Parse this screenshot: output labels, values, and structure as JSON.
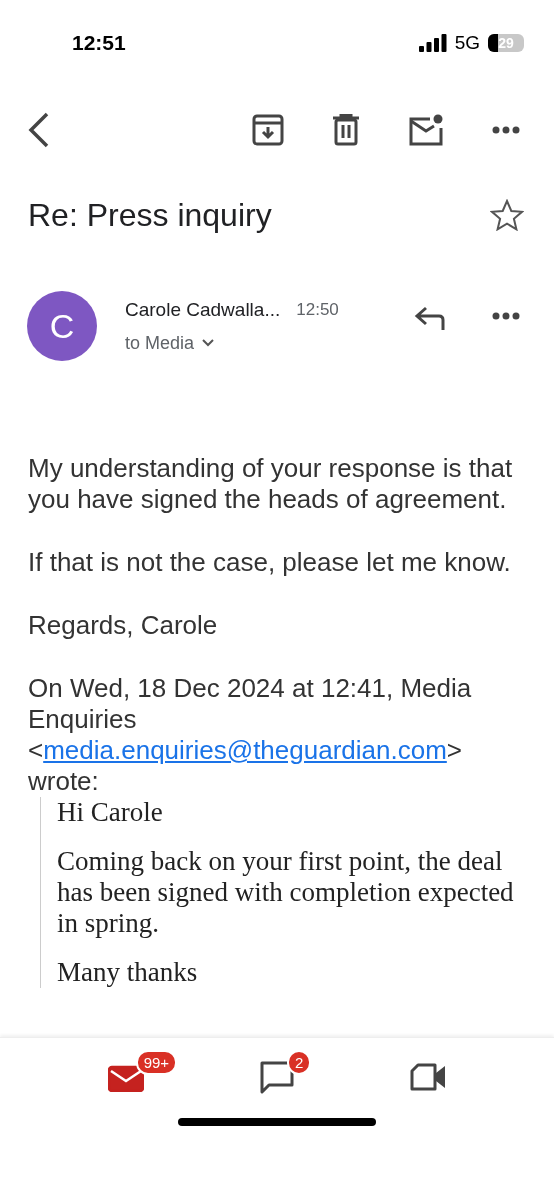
{
  "status_bar": {
    "time": "12:51",
    "network": "5G",
    "battery": "29"
  },
  "subject": "Re: Press inquiry",
  "starred": false,
  "message": {
    "avatar_letter": "C",
    "sender": "Carole Cadwalla...",
    "time": "12:50",
    "recipients": "to Media"
  },
  "body": [
    "My understanding of your response is that you have signed the heads of agreement.",
    "If that is not the case, please let me know.",
    "Regards, Carole"
  ],
  "attribution": {
    "prefix": "On Wed, 18 Dec 2024 at 12:41, Media Enquiries <",
    "link": "media.enquiries@theguardian.com",
    "suffix": "> wrote:"
  },
  "quoted": [
    "Hi Carole",
    "Coming back on your first point, the deal has been signed with completion expected in spring.",
    "Many thanks"
  ],
  "nav": [
    {
      "kind": "mail",
      "badge": "99+",
      "selected": true
    },
    {
      "kind": "chat",
      "badge": "2",
      "selected": false
    },
    {
      "kind": "meet",
      "selected": false
    }
  ]
}
